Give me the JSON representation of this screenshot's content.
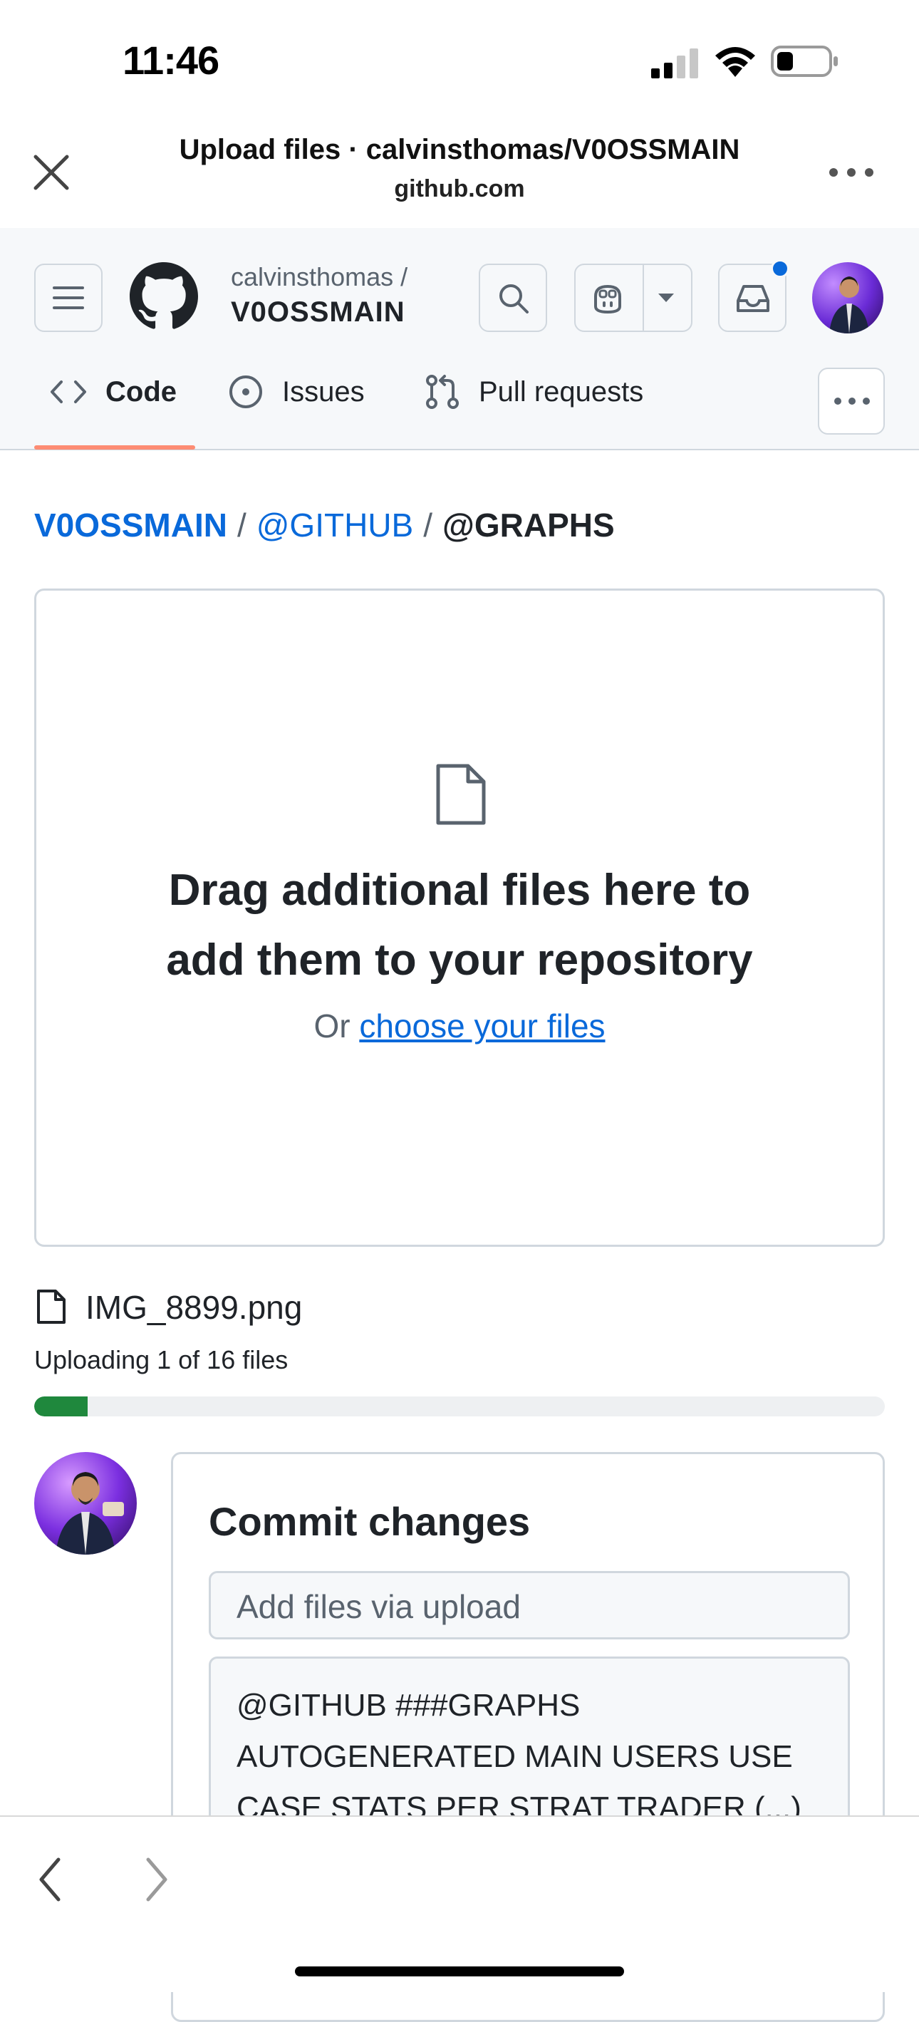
{
  "status_bar": {
    "time": "11:46"
  },
  "browser": {
    "title": "Upload files · calvinsthomas/V0OSSMAIN",
    "domain": "github.com"
  },
  "repo_header": {
    "owner": "calvinsthomas /",
    "repo": "V0OSSMAIN"
  },
  "tabs": [
    {
      "label": "Code",
      "icon": "code-icon",
      "active": true
    },
    {
      "label": "Issues",
      "icon": "issue-icon"
    },
    {
      "label": "Pull requests",
      "icon": "pull-request-icon"
    }
  ],
  "breadcrumb": {
    "root": "V0OSSMAIN",
    "sep1": "/",
    "dir1": "@GITHUB",
    "sep2": "/",
    "dir2": "@GRAPHS"
  },
  "dropzone": {
    "line1": "Drag additional files here to",
    "line2": "add them to your repository",
    "or": "Or ",
    "choose": "choose your files"
  },
  "upload": {
    "file_name": "IMG_8899.png",
    "status": "Uploading 1 of 16 files",
    "progress_fraction": 0.0625
  },
  "commit": {
    "title": "Commit changes",
    "summary_placeholder": "Add files via upload",
    "description": "@GITHUB ###GRAPHS AUTOGENERATED MAIN USERS USE CASE STATS PER STRAT TRADER (...)"
  },
  "colors": {
    "accent_link": "#0969da",
    "tab_underline": "#fd8c73",
    "progress": "#1f883d",
    "notification_dot": "#0969da"
  }
}
